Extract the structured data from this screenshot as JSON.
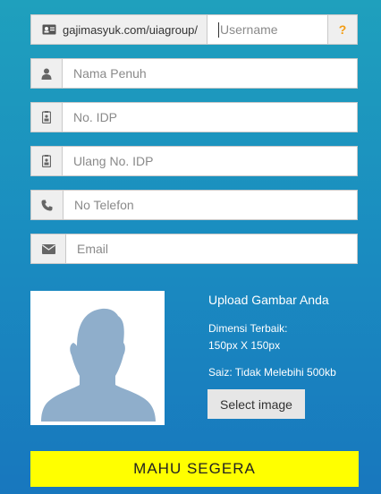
{
  "username_row": {
    "url_prefix": "gajimasyuk.com/uiagroup/",
    "username_placeholder": "Username",
    "help_label": "?"
  },
  "fields": {
    "full_name": "Nama Penuh",
    "idp": "No. IDP",
    "repeat_idp": "Ulang No. IDP",
    "phone": "No Telefon",
    "email": "Email"
  },
  "upload": {
    "title": "Upload Gambar Anda",
    "dimension_label": "Dimensi Terbaik:",
    "dimension_value": "150px X 150px",
    "size_label": "Saiz: Tidak Melebihi 500kb",
    "select_button": "Select image"
  },
  "submit_label": "MAHU SEGERA",
  "colors": {
    "submit_bg": "#ffff00",
    "help_accent": "#f39c12"
  }
}
